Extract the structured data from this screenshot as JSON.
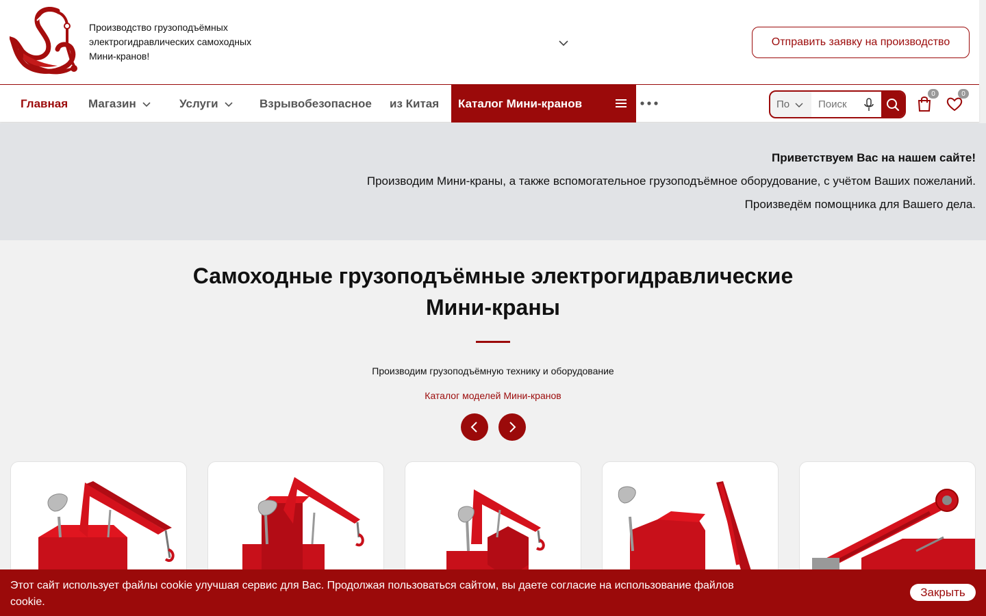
{
  "header": {
    "tagline": "Производство грузоподъёмных электрогидравлических самоходных Мини-кранов!",
    "cta_label": "Отправить заявку на производство"
  },
  "nav": {
    "items": [
      {
        "label": "Главная",
        "active": true
      },
      {
        "label": "Магазин",
        "dropdown": true
      },
      {
        "label": "Услуги",
        "dropdown": true
      },
      {
        "label": "Взрывобезопасное"
      },
      {
        "label": "из Китая"
      }
    ],
    "catalog_label": "Каталог Мини-кранов",
    "search": {
      "select_value": "По",
      "placeholder": "Поиск"
    },
    "cart_count": "0",
    "favorites_count": "0"
  },
  "welcome": {
    "line1": "Приветствуем Вас на нашем сайте!",
    "line2": "Производим Мини-краны, а также вспомогательное грузоподъёмное оборудование, с учётом Ваших пожеланий.",
    "line3": "Произведём помощника для Вашего дела."
  },
  "section": {
    "title_line1": "Самоходные грузоподъёмные электрогидравлические",
    "title_line2": "Мини-краны",
    "subtitle": "Производим грузоподъёмную технику и оборудование",
    "catalog_link": "Каталог моделей Мини-кранов"
  },
  "cookie": {
    "text": "Этот сайт использует файлы cookie  улучшая сервис для Вас. Продолжая пользоваться сайтом, вы даете согласие на использование файлов cookie.",
    "close_label": "Закрыть"
  },
  "colors": {
    "brand": "#9b0a0a",
    "welcome_bg": "#e1e3e6",
    "page_bg": "#f1f1f1"
  },
  "icons": [
    "swan-logo",
    "chevron-down-icon",
    "hamburger-menu-icon",
    "more-dots-icon",
    "microphone-icon",
    "search-icon",
    "cart-icon",
    "heart-icon",
    "arrow-left-icon",
    "arrow-right-icon"
  ]
}
